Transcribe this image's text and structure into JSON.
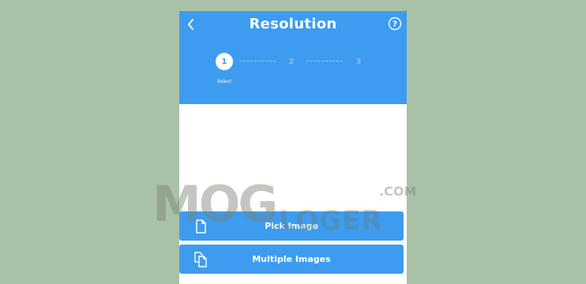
{
  "header": {
    "title": "Resolution",
    "back_icon": "chevron-left-icon",
    "help_icon": "help-circle-icon"
  },
  "steps": [
    {
      "number": "1",
      "label": "Select",
      "active": true
    },
    {
      "number": "2",
      "label": "",
      "active": false
    },
    {
      "number": "3",
      "label": "",
      "active": false
    }
  ],
  "actions": {
    "pick_image": {
      "label": "Pick Image",
      "icon": "file-icon"
    },
    "multiple_images": {
      "label": "Multiple Images",
      "icon": "files-icon"
    }
  },
  "watermark": {
    "main": "MOG",
    "sub": "LOGER",
    "suffix": ".COM"
  },
  "colors": {
    "accent": "#3d9cf0",
    "background": "#a9c1a6",
    "surface": "#ffffff"
  }
}
